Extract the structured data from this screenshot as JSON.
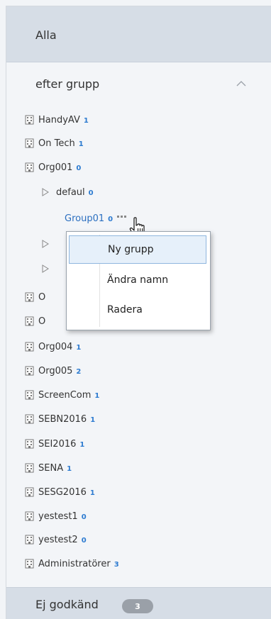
{
  "header": {
    "all_label": "Alla"
  },
  "section": {
    "title": "efter grupp"
  },
  "tree": {
    "items": [
      {
        "label": "HandyAV",
        "count": "1"
      },
      {
        "label": "On Tech",
        "count": "1"
      },
      {
        "label": "Org001",
        "count": "0"
      },
      {
        "label": "defaul",
        "count": "0"
      },
      {
        "label": "Group01",
        "count": "0"
      },
      {
        "label": "O",
        "count": ""
      },
      {
        "label": "O",
        "count": ""
      },
      {
        "label": "Org004",
        "count": "1"
      },
      {
        "label": "Org005",
        "count": "2"
      },
      {
        "label": "ScreenCom",
        "count": "1"
      },
      {
        "label": "SEBN2016",
        "count": "1"
      },
      {
        "label": "SEI2016",
        "count": "1"
      },
      {
        "label": "SENA",
        "count": "1"
      },
      {
        "label": "SESG2016",
        "count": "1"
      },
      {
        "label": "yestest1",
        "count": "0"
      },
      {
        "label": "yestest2",
        "count": "0"
      },
      {
        "label": "Administratörer",
        "count": "3"
      }
    ]
  },
  "context_menu": {
    "items": [
      {
        "label": "Ny grupp"
      },
      {
        "label": "Ändra namn"
      },
      {
        "label": "Radera"
      }
    ]
  },
  "footer": {
    "label": "Ej godkänd",
    "badge": "3"
  },
  "colors": {
    "accent": "#2d7bd0",
    "header_bg": "#d6dde6",
    "panel_bg": "#f3f5f8"
  }
}
